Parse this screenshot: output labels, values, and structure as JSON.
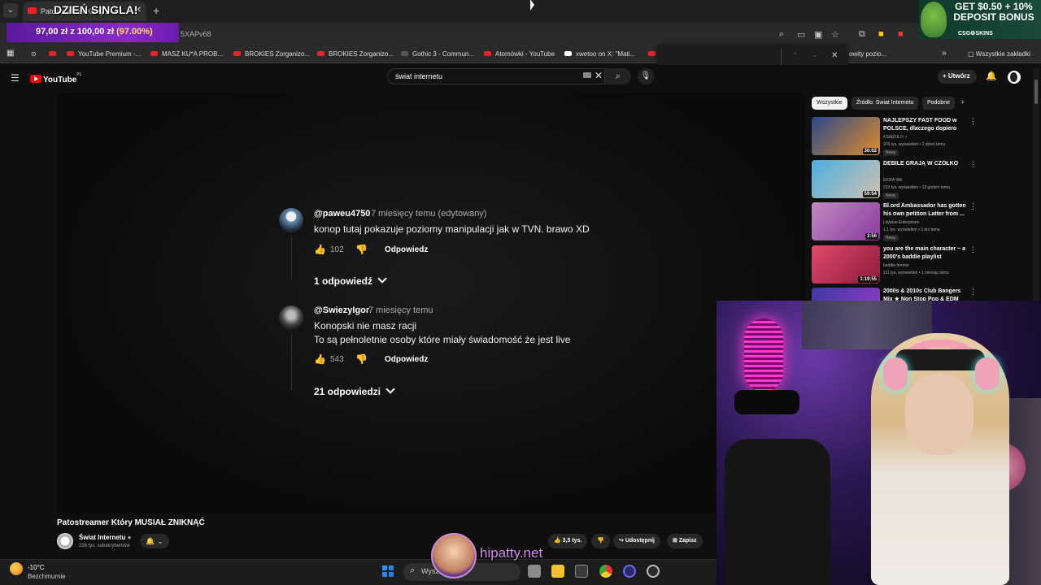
{
  "browser": {
    "tab_title": "Patostreamer Który...",
    "url": "5XAPv68",
    "bookmarks": [
      {
        "label": "YouTube Premium -..."
      },
      {
        "label": "MASZ KU*A PROB..."
      },
      {
        "label": "BROKIES Zorganizo..."
      },
      {
        "label": "BROKIES Zorganizo..."
      },
      {
        "label": "Gothic 3 - Commun..."
      },
      {
        "label": "Atomówki - YouTube"
      },
      {
        "label": "xwetoo on X: \"Mati..."
      },
      {
        "label": "owity pozio..."
      }
    ],
    "all_bookmarks": "Wszystkie zakładki"
  },
  "overlays": {
    "banner": "DZIEŃ SINGLA!",
    "donation_amount": "97,00 zł z 100,00 zł",
    "donation_pct": "(97.00%)",
    "promo_line1": "GET $0.50 + 10%",
    "promo_line2": "DEPOSIT BONUS",
    "promo_brand": "CSG⚙SKINS",
    "watermark": "hipatty.net"
  },
  "youtube": {
    "logo": "YouTube",
    "logo_region": "PL",
    "search_value": "świat internetu",
    "create_label": "Utwórz"
  },
  "comments": [
    {
      "author": "@paweu4750",
      "time": "7 miesięcy temu (edytowany)",
      "text_line1": "konop tutaj pokazuje poziomy manipulacji jak w TVN. brawo XD",
      "text_line2": "",
      "likes": "102",
      "reply_label": "Odpowiedz",
      "replies_label": "1 odpowiedź"
    },
    {
      "author": "@SwiezyIgor",
      "time": "7 miesięcy temu",
      "text_line1": "Konopski nie masz racji",
      "text_line2": "To są pełnoletnie osoby które miały świadomość że jest live",
      "likes": "543",
      "reply_label": "Odpowiedz",
      "replies_label": "21 odpowiedzi"
    }
  ],
  "video": {
    "title": "Patostreamer Który MUSIAŁ ZNIKNĄĆ",
    "channel": "Świat Internetu",
    "subscribers": "226 tys. subskrybentów",
    "likes": "3,5 tys.",
    "share": "Udostępnij",
    "save": "Zapisz"
  },
  "chips": [
    "Wszystkie",
    "Źródło: Świat Internetu",
    "Podobne"
  ],
  "recommendations": [
    {
      "title": "NAJLEPSZY FAST FOOD w POLSCE, dlaczego dopiero ter...",
      "channel": "KSIĄŻULO ✓",
      "meta": "976 tys. wyświetleń • 1 dzień temu",
      "badge": "Nowy",
      "duration": "30:02",
      "color_a": "#2a4a8a",
      "color_b": "#e08a2a"
    },
    {
      "title": "DEBILE GRAJĄ W CZÓŁKO",
      "channel": "EKIPA WK",
      "meta": "232 tys. wyświetleń • 13 godzin temu",
      "badge": "Nowy",
      "duration": "59:54",
      "color_a": "#4ab0e0",
      "color_b": "#d0c0b0"
    },
    {
      "title": "Bl.ord Ambassador has gotten his own petition Latter from ...",
      "channel": "Lilywise Enterprises",
      "meta": "1,1 tys. wyświetleń • 3 dni temu",
      "badge": "Nowy",
      "duration": "3:56",
      "color_a": "#c08ac0",
      "color_b": "#8a3aa0"
    },
    {
      "title": "you are the main character ~ a 2000's baddie playlist",
      "channel": "baddie femme",
      "meta": "111 tys. wyświetleń • 1 miesiąc temu",
      "badge": "",
      "duration": "1:19:55",
      "color_a": "#e04a6a",
      "color_b": "#8a1a3a"
    },
    {
      "title": "2000s & 2010s Club Bangers Mix ★ Non Stop Pop & EDM",
      "channel": "",
      "meta": "",
      "badge": "",
      "duration": "",
      "color_a": "#3a3aa0",
      "color_b": "#a03ad0"
    }
  ],
  "taskbar": {
    "temperature": "-10°C",
    "weather": "Bezchmurnie",
    "search_placeholder": "Wysz"
  }
}
